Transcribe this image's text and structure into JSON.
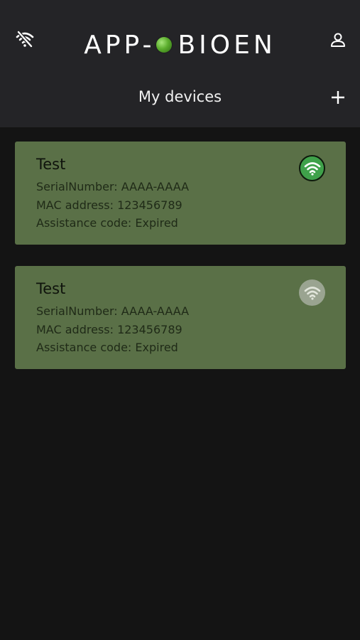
{
  "header": {
    "logo_left": "APP-",
    "logo_right": "BIOEN",
    "title": "My devices",
    "wifi_off_icon": "wifi-off-icon",
    "profile_icon": "user-icon",
    "add_icon": "plus-icon"
  },
  "devices": [
    {
      "name": "Test",
      "serial": "SerialNumber: AAAA-AAAA",
      "mac": "MAC address: 123456789",
      "assistance": "Assistance code: Expired",
      "status": "online",
      "status_icon": "wifi-icon",
      "status_color": "#3fa14a"
    },
    {
      "name": "Test",
      "serial": "SerialNumber: AAAA-AAAA",
      "mac": "MAC address: 123456789",
      "assistance": "Assistance code: Expired",
      "status": "offline",
      "status_icon": "wifi-icon",
      "status_color": "#9aa491"
    }
  ],
  "colors": {
    "background": "#141414",
    "header": "#242427",
    "card": "#5a7047",
    "logo_accent": "#5cae2e"
  }
}
